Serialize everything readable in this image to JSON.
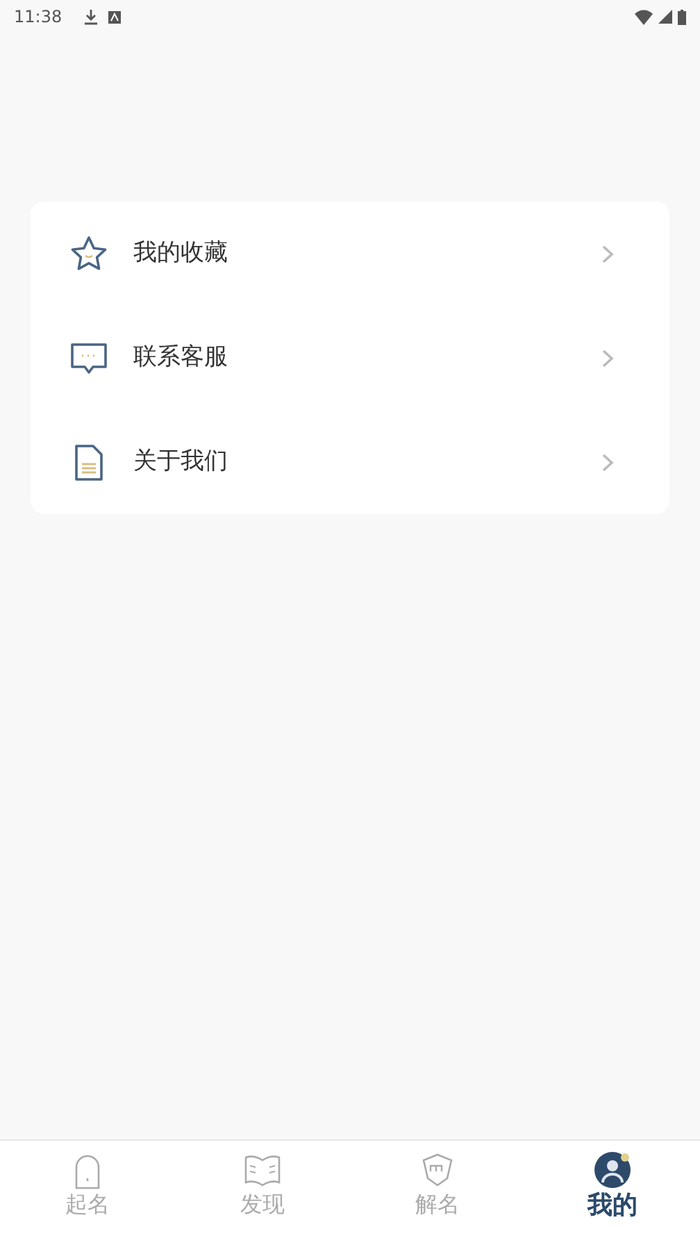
{
  "status_bar": {
    "time": "11:38"
  },
  "menu": [
    {
      "kind": "star",
      "label": "我的收藏"
    },
    {
      "kind": "chat",
      "label": "联系客服"
    },
    {
      "kind": "doc",
      "label": "关于我们"
    }
  ],
  "tabs": [
    {
      "kind": "door",
      "label": "起名",
      "selected": false
    },
    {
      "kind": "book",
      "label": "发现",
      "selected": false
    },
    {
      "kind": "badge",
      "label": "解名",
      "selected": false
    },
    {
      "kind": "avatar",
      "label": "我的",
      "selected": true
    }
  ]
}
